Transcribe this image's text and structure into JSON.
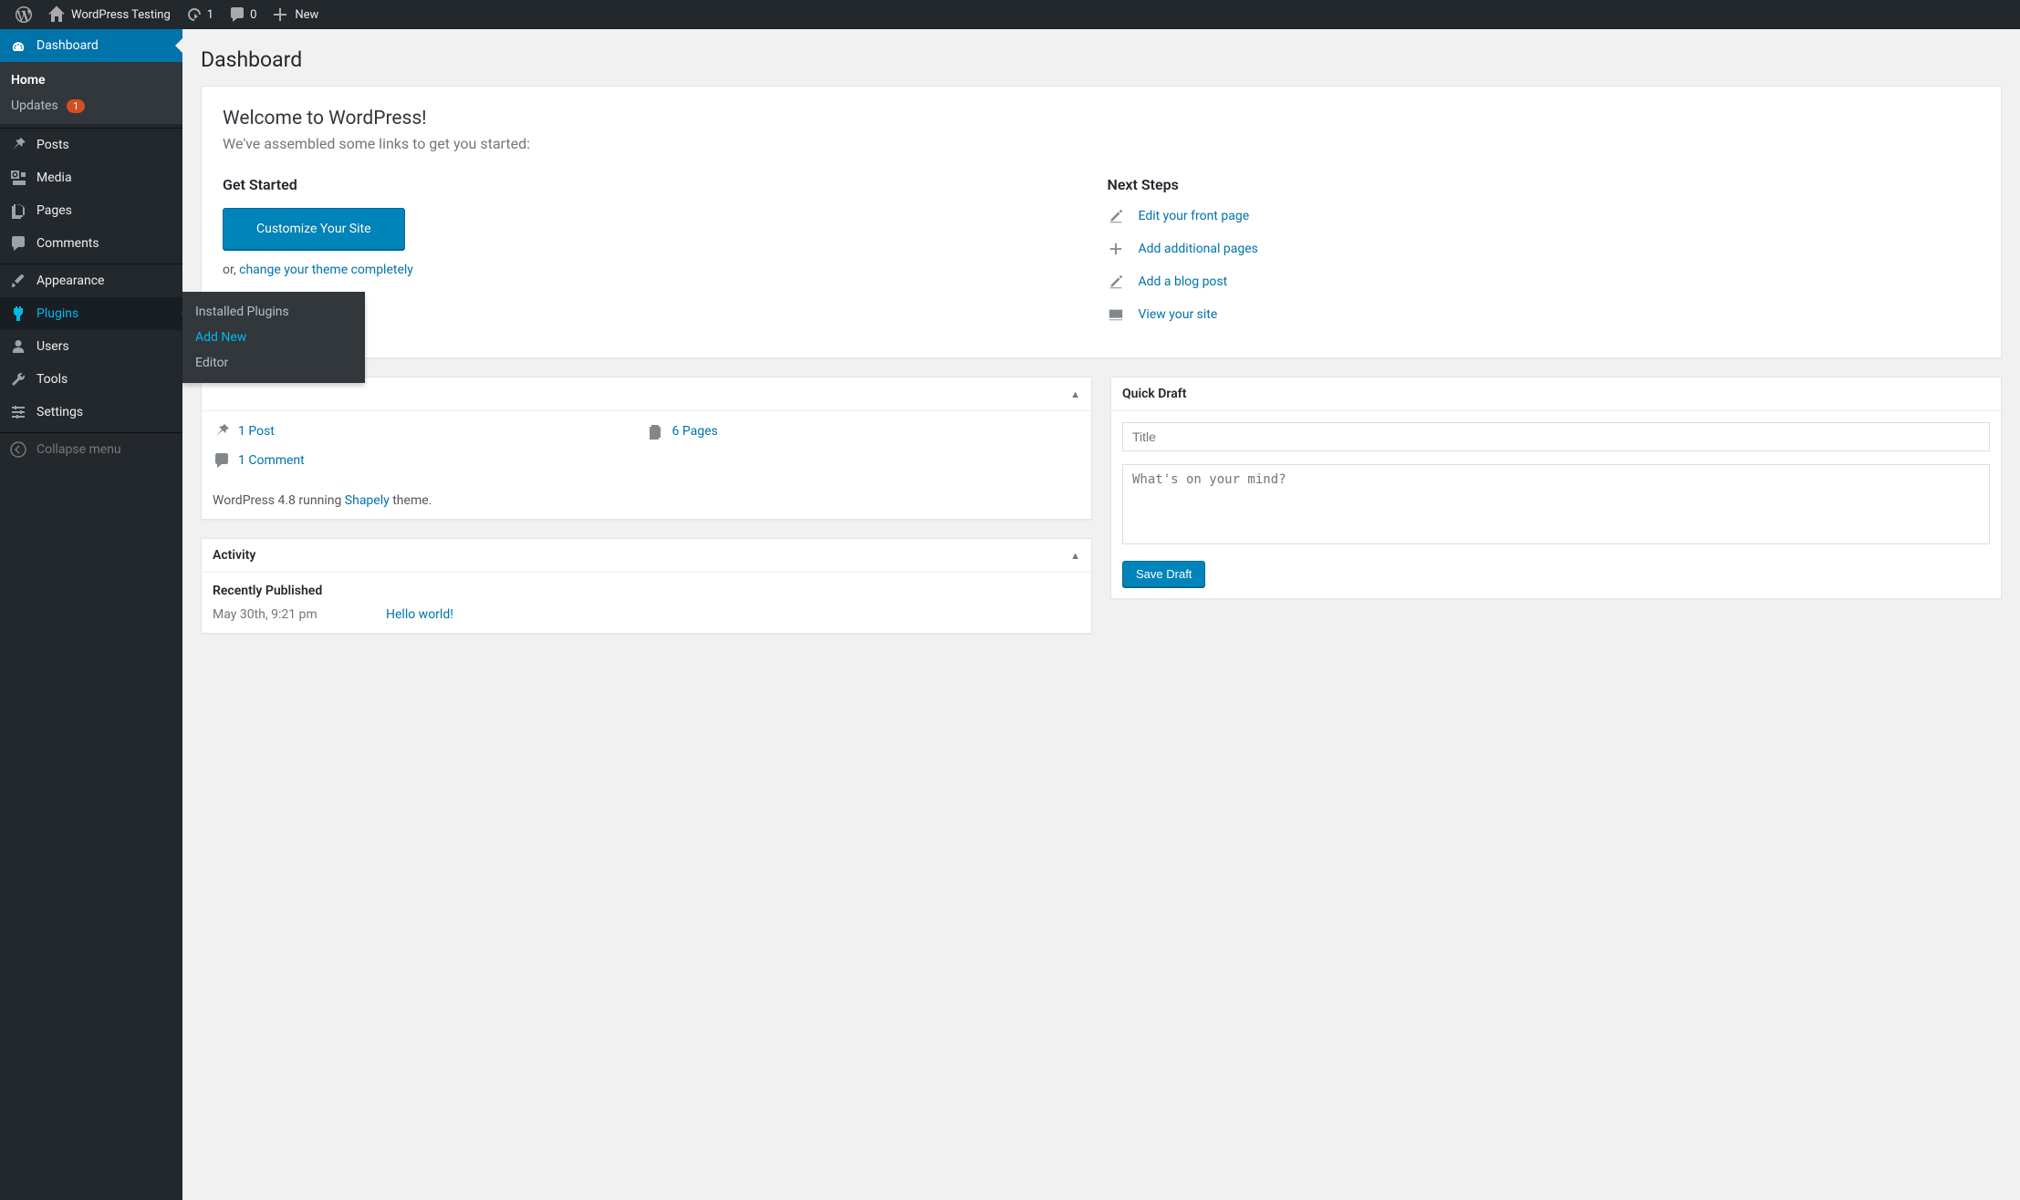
{
  "toolbar": {
    "site_name": "WordPress Testing",
    "updates_count": "1",
    "comments_count": "0",
    "new_label": "New"
  },
  "sidebar": {
    "dashboard": {
      "label": "Dashboard"
    },
    "dashboard_sub": {
      "home": "Home",
      "updates": "Updates",
      "updates_count": "1"
    },
    "posts": "Posts",
    "media": "Media",
    "pages": "Pages",
    "comments": "Comments",
    "appearance": "Appearance",
    "plugins": "Plugins",
    "users": "Users",
    "tools": "Tools",
    "settings": "Settings",
    "collapse": "Collapse menu",
    "plugins_flyout": {
      "installed": "Installed Plugins",
      "add_new": "Add New",
      "editor": "Editor"
    }
  },
  "page": {
    "title": "Dashboard"
  },
  "welcome": {
    "title": "Welcome to WordPress!",
    "subtitle": "We've assembled some links to get you started:",
    "get_started_heading": "Get Started",
    "customize_btn": "Customize Your Site",
    "or_text": "or, ",
    "change_theme": "change your theme completely",
    "next_steps_heading": "Next Steps",
    "steps": {
      "edit_front": "Edit your front page",
      "add_pages": "Add additional pages",
      "add_post": "Add a blog post",
      "view_site": "View your site"
    }
  },
  "glance": {
    "posts": "1 Post",
    "pages": "6 Pages",
    "comments": "1 Comment",
    "footer_pre": "WordPress 4.8 running ",
    "footer_theme": "Shapely",
    "footer_post": " theme."
  },
  "activity": {
    "heading": "Activity",
    "recently_pub": "Recently Published",
    "row_date": "May 30th, 9:21 pm",
    "row_title": "Hello world!"
  },
  "quickdraft": {
    "heading": "Quick Draft",
    "title_placeholder": "Title",
    "content_placeholder": "What's on your mind?",
    "save_btn": "Save Draft"
  }
}
